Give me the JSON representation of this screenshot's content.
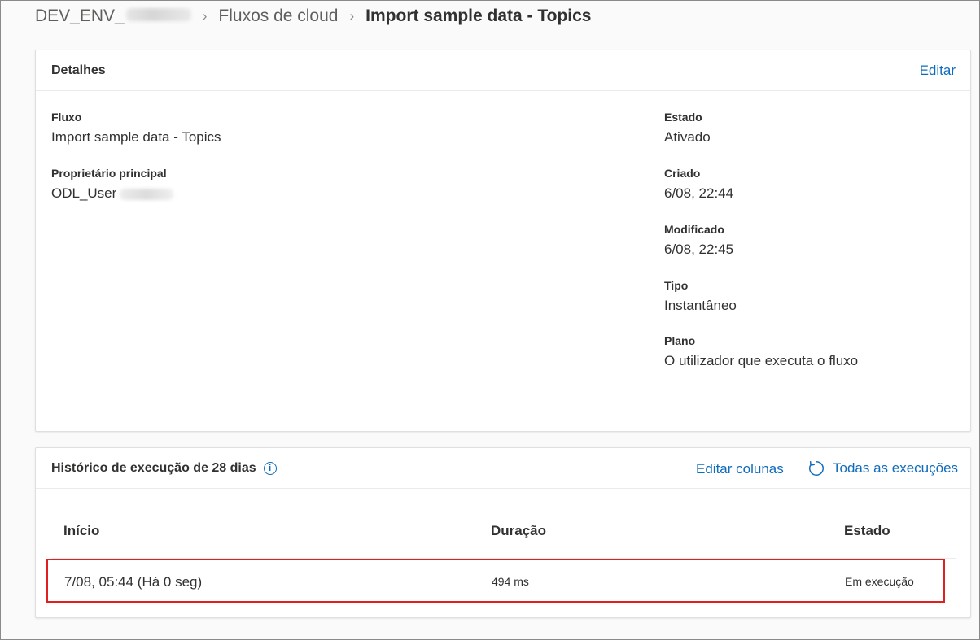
{
  "breadcrumb": {
    "env": "DEV_ENV_",
    "section": "Fluxos de cloud",
    "current": "Import sample data - Topics"
  },
  "details": {
    "title": "Detalhes",
    "edit_label": "Editar",
    "flow_label": "Fluxo",
    "flow_value": "Import sample data - Topics",
    "owner_label": "Proprietário principal",
    "owner_value": "ODL_User",
    "state_label": "Estado",
    "state_value": "Ativado",
    "created_label": "Criado",
    "created_value": "6/08, 22:44",
    "modified_label": "Modificado",
    "modified_value": "6/08, 22:45",
    "type_label": "Tipo",
    "type_value": "Instantâneo",
    "plan_label": "Plano",
    "plan_value": "O utilizador que executa o fluxo"
  },
  "history": {
    "title": "Histórico de execução de 28 dias",
    "info_icon": "info-icon",
    "edit_columns_label": "Editar colunas",
    "all_runs_label": "Todas as execuções",
    "columns": [
      "Início",
      "Duração",
      "Estado"
    ],
    "rows": [
      {
        "start": "7/08, 05:44 (Há 0 seg)",
        "duration": "494 ms",
        "status": "Em execução"
      }
    ]
  },
  "colors": {
    "link": "#0f6cbd",
    "highlight": "#e02020"
  }
}
